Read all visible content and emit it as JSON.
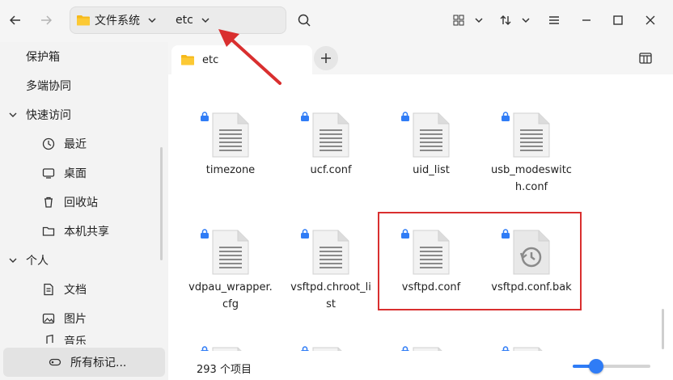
{
  "toolbar": {
    "back_icon": "arrow-left-icon",
    "forward_icon": "arrow-right-icon",
    "path": [
      {
        "label": "文件系统",
        "icon": "folder-icon"
      },
      {
        "label": "etc"
      }
    ],
    "search_icon": "search-icon",
    "view_icon": "grid-view-icon",
    "sort_icon": "sort-icon",
    "menu_icon": "hamburger-menu-icon",
    "window_controls": [
      "minimize",
      "maximize",
      "close"
    ]
  },
  "sidebar": {
    "items": [
      {
        "label": "保护箱"
      },
      {
        "label": "多端协同"
      },
      {
        "label": "快速访问",
        "group": true
      },
      {
        "label": "最近",
        "icon": "clock-icon"
      },
      {
        "label": "桌面",
        "icon": "desktop-icon"
      },
      {
        "label": "回收站",
        "icon": "trash-icon"
      },
      {
        "label": "本机共享",
        "icon": "folder-share-icon"
      },
      {
        "label": "个人",
        "group": true
      },
      {
        "label": "文档",
        "icon": "document-icon"
      },
      {
        "label": "图片",
        "icon": "picture-icon"
      },
      {
        "label": "音乐",
        "icon": "music-icon"
      },
      {
        "label": "所有标记...",
        "icon": "tag-icon"
      }
    ]
  },
  "tab": {
    "label": "etc"
  },
  "files": [
    {
      "name": "timezone",
      "type": "text"
    },
    {
      "name": "ucf.conf",
      "type": "text"
    },
    {
      "name": "uid_list",
      "type": "text"
    },
    {
      "name": "usb_modeswitch.conf",
      "display": "usb_modeswitc\nh.conf",
      "type": "text"
    },
    {
      "name": "vdpau_wrapper.cfg",
      "display": "vdpau_wrapper.\ncfg",
      "type": "text"
    },
    {
      "name": "vsftpd.chroot_list",
      "display": "vsftpd.chroot_li\nst",
      "type": "text"
    },
    {
      "name": "vsftpd.conf",
      "type": "text"
    },
    {
      "name": "vsftpd.conf.bak",
      "type": "backup"
    }
  ],
  "status": {
    "count": "293 个项目",
    "zoom_level": 0.3
  },
  "annotation": {
    "highlight_color": "#d92f2f",
    "accent": "#2f7cf6"
  }
}
